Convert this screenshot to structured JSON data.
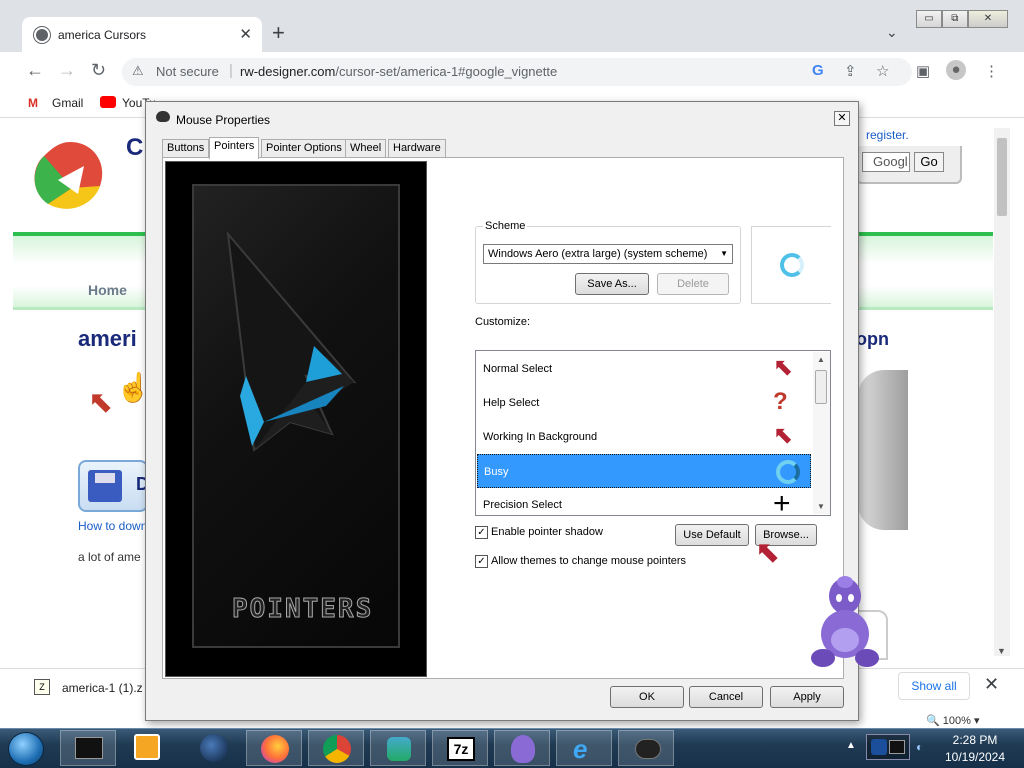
{
  "browser": {
    "tab_title": "america Cursors",
    "url_security": "Not secure",
    "url_host": "rw-designer.com",
    "url_path": "/cursor-set/america-1#google_vignette",
    "bookmarks": [
      {
        "label": "Gmail",
        "icon": "gmail-icon"
      },
      {
        "label": "YouTu",
        "icon": "youtube-icon"
      }
    ],
    "window_buttons": {
      "minimize": "▭",
      "restore": "⧉",
      "close": "✕"
    }
  },
  "page": {
    "header_c": "C",
    "register_link": "register.",
    "search_placeholder": "Googl",
    "go_label": "Go",
    "nav_home": "Home",
    "heading": "ameri",
    "heading_right": "opn",
    "download_letter": "D",
    "howto_link": "How to down",
    "description": "a lot of ame"
  },
  "download_bar": {
    "filename": "america-1 (1).z",
    "show_all": "Show all"
  },
  "zoom": "100%",
  "dialog": {
    "title": "Mouse Properties",
    "tabs": [
      "Buttons",
      "Pointers",
      "Pointer Options",
      "Wheel",
      "Hardware"
    ],
    "active_tab": "Pointers",
    "preview_brand": "POINTERS",
    "scheme_label": "Scheme",
    "scheme_value": "Windows Aero (extra large) (system scheme)",
    "save_as": "Save As...",
    "delete": "Delete",
    "customize_label": "Customize:",
    "cursor_rows": [
      {
        "label": "Normal Select",
        "glyph": "⬉",
        "selected": false
      },
      {
        "label": "Help Select",
        "glyph": "?",
        "selected": false
      },
      {
        "label": "Working In Background",
        "glyph": "⬉",
        "selected": false
      },
      {
        "label": "Busy",
        "glyph": "◌",
        "selected": true
      },
      {
        "label": "Precision Select",
        "glyph": "+",
        "selected": false
      }
    ],
    "enable_shadow": "Enable pointer shadow",
    "allow_themes": "Allow themes to change mouse pointers",
    "use_default": "Use Default",
    "browse": "Browse...",
    "ok": "OK",
    "cancel": "Cancel",
    "apply": "Apply"
  },
  "taskbar": {
    "time": "2:28 PM",
    "date": "10/19/2024",
    "apps": [
      "start-orb-icon",
      "cmd-icon",
      "media-icon",
      "globe-icon",
      "firefox-icon",
      "chrome-icon",
      "network-people-icon",
      "7zip-icon",
      "purple-character-icon",
      "ie-icon",
      "mouse-icon"
    ]
  },
  "colors": {
    "selection": "#3399ff",
    "link": "#1a5dc6",
    "heading": "#1a2a7a",
    "green_accent": "#2fbf4f",
    "taskbar": "#1f3a52"
  }
}
